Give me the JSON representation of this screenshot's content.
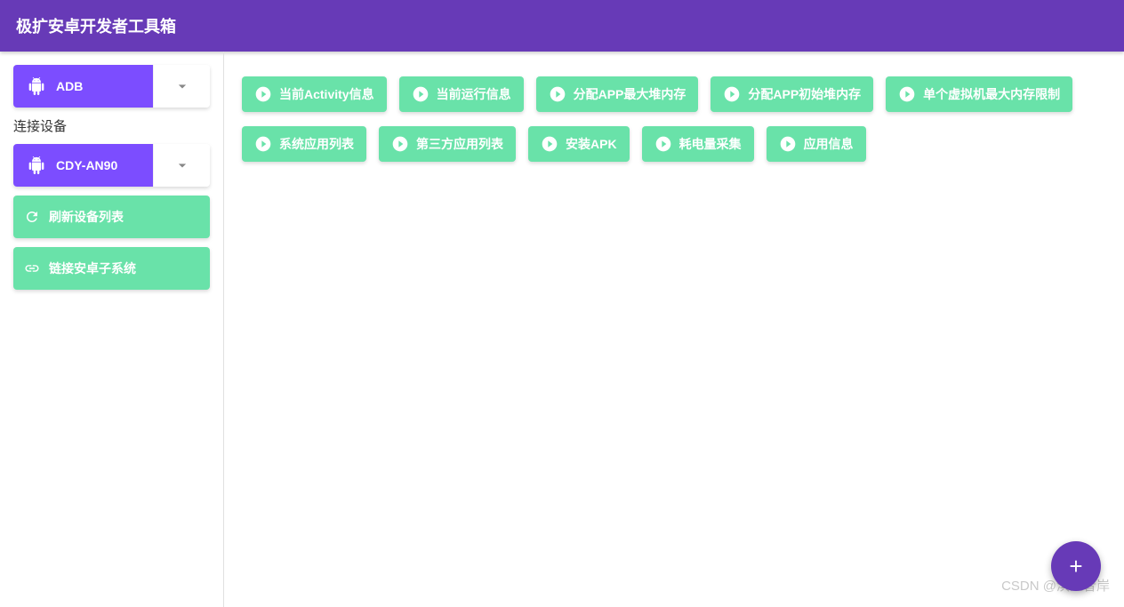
{
  "header": {
    "title": "极扩安卓开发者工具箱"
  },
  "sidebar": {
    "adb_dropdown": {
      "label": "ADB"
    },
    "section_label": "连接设备",
    "device_dropdown": {
      "label": "CDY-AN90"
    },
    "refresh_button": "刷新设备列表",
    "link_button": "链接安卓子系统"
  },
  "actions": {
    "row1": [
      "当前Activity信息",
      "当前运行信息",
      "分配APP最大堆内存",
      "分配APP初始堆内存",
      "单个虚拟机最大内存限制"
    ],
    "row2": [
      "系统应用列表",
      "第三方应用列表",
      "安装APK",
      "耗电量采集",
      "应用信息"
    ]
  },
  "fab": {
    "icon": "+"
  },
  "watermark": "CSDN @滨江昔岸"
}
